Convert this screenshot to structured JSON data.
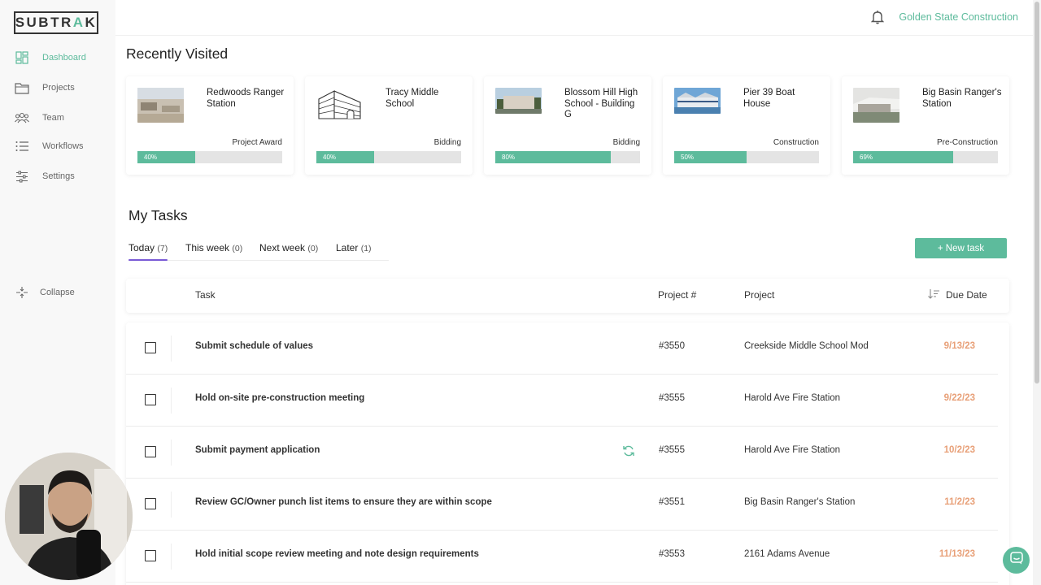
{
  "app": {
    "logo_text_pre": "SUBTR",
    "logo_text_accent": "A",
    "logo_text_post": "K",
    "company": "Golden State Construction"
  },
  "sidebar": {
    "items": [
      {
        "label": "Dashboard",
        "icon": "dashboard-icon"
      },
      {
        "label": "Projects",
        "icon": "folder-icon"
      },
      {
        "label": "Team",
        "icon": "team-icon"
      },
      {
        "label": "Workflows",
        "icon": "list-icon"
      },
      {
        "label": "Settings",
        "icon": "sliders-icon"
      }
    ],
    "collapse_label": "Collapse"
  },
  "recent": {
    "title": "Recently Visited",
    "cards": [
      {
        "name": "Redwoods Ranger Station",
        "phase": "Project Award",
        "progress": 40,
        "progress_label": "40%"
      },
      {
        "name": "Tracy Middle School",
        "phase": "Bidding",
        "progress": 40,
        "progress_label": "40%"
      },
      {
        "name": "Blossom Hill High School - Building G",
        "phase": "Bidding",
        "progress": 80,
        "progress_label": "80%"
      },
      {
        "name": "Pier 39 Boat House",
        "phase": "Construction",
        "progress": 50,
        "progress_label": "50%"
      },
      {
        "name": "Big Basin Ranger's Station",
        "phase": "Pre-Construction",
        "progress": 69,
        "progress_label": "69%"
      }
    ]
  },
  "tasks": {
    "title": "My Tasks",
    "tabs": [
      {
        "label": "Today",
        "count": "(7)"
      },
      {
        "label": "This week",
        "count": "(0)"
      },
      {
        "label": "Next week",
        "count": "(0)"
      },
      {
        "label": "Later",
        "count": "(1)"
      }
    ],
    "new_task_label": "+ New task",
    "columns": {
      "task": "Task",
      "project_num": "Project #",
      "project": "Project",
      "due": "Due Date"
    },
    "rows": [
      {
        "task": "Submit schedule of values",
        "project_num": "#3550",
        "project": "Creekside Middle School Mod",
        "due": "9/13/23",
        "recurring": false
      },
      {
        "task": "Hold on-site pre-construction meeting",
        "project_num": "#3555",
        "project": "Harold Ave Fire Station",
        "due": "9/22/23",
        "recurring": false
      },
      {
        "task": "Submit payment application",
        "project_num": "#3555",
        "project": "Harold Ave Fire Station",
        "due": "10/2/23",
        "recurring": true
      },
      {
        "task": "Review GC/Owner punch list items to ensure they are within scope",
        "project_num": "#3551",
        "project": "Big Basin Ranger's Station",
        "due": "11/2/23",
        "recurring": false
      },
      {
        "task": "Hold initial scope review meeting and note design requirements",
        "project_num": "#3553",
        "project": "2161 Adams Avenue",
        "due": "11/13/23",
        "recurring": false
      }
    ]
  },
  "colors": {
    "accent": "#5dbb9c",
    "due": "#e8a078",
    "tab_underline": "#7a5ad6"
  }
}
